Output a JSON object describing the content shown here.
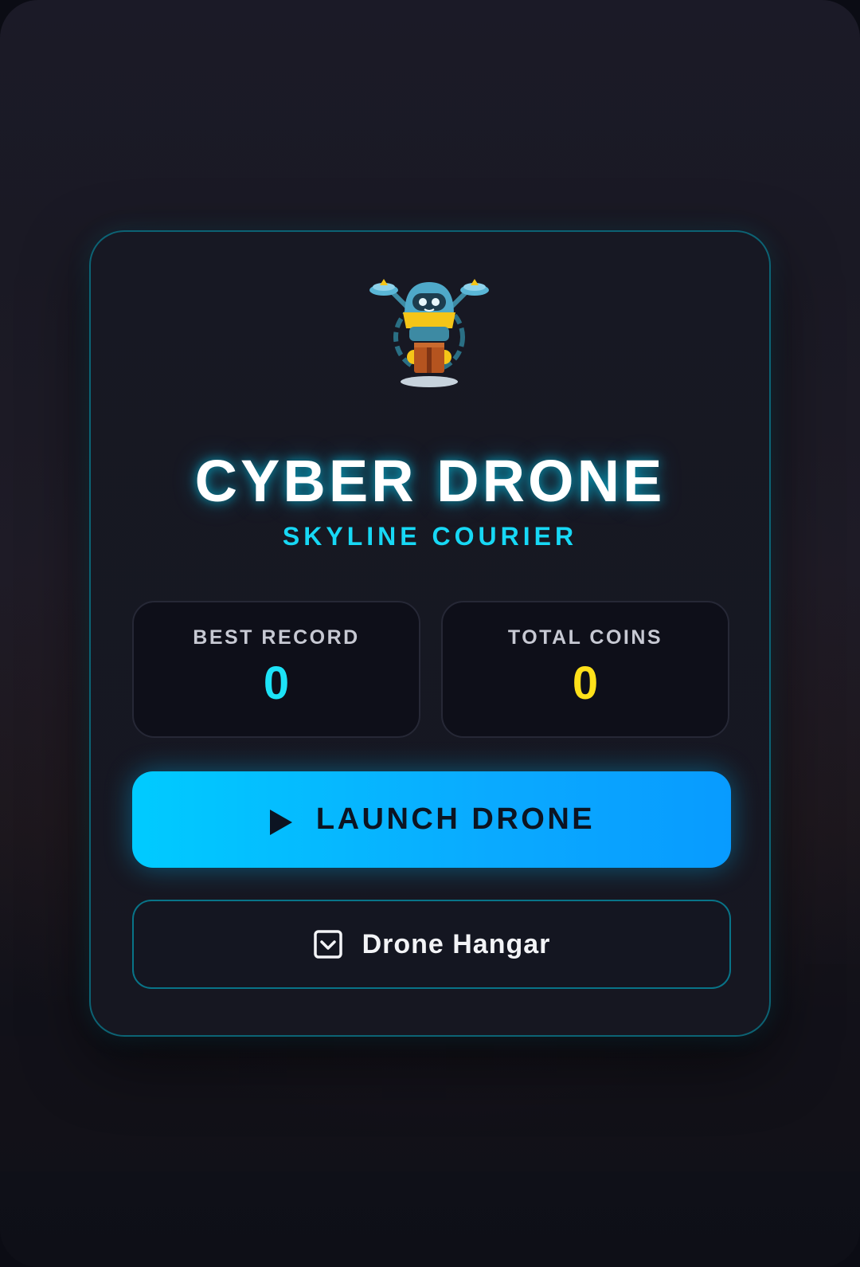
{
  "game": {
    "title": "CYBER DRONE",
    "subtitle": "SKYLINE COURIER"
  },
  "stats": {
    "best_record": {
      "label": "BEST RECORD",
      "value": "0"
    },
    "total_coins": {
      "label": "TOTAL COINS",
      "value": "0"
    }
  },
  "actions": {
    "launch": {
      "label": "LAUNCH DRONE",
      "icon": "play-icon"
    },
    "hangar": {
      "label": "Drone Hangar",
      "icon": "checkbox-chevron-icon"
    }
  },
  "colors": {
    "accent_cyan": "#1de3f7",
    "coin_gold": "#ffe11a",
    "button_gradient_start": "#00cbff",
    "button_gradient_end": "#089bff"
  }
}
